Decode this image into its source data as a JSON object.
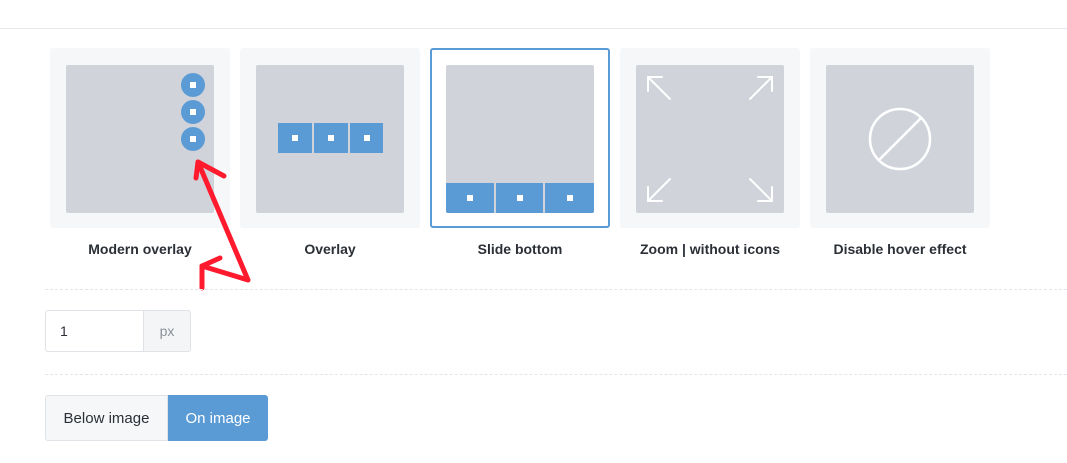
{
  "hover_effects": [
    {
      "label": "Modern overlay",
      "icon": "modern-overlay-thumbnail",
      "selected": false
    },
    {
      "label": "Overlay",
      "icon": "overlay-thumbnail",
      "selected": false
    },
    {
      "label": "Slide bottom",
      "icon": "slide-bottom-thumbnail",
      "selected": true
    },
    {
      "label": "Zoom | without icons",
      "icon": "zoom-thumbnail",
      "selected": false
    },
    {
      "label": "Disable hover effect",
      "icon": "disable-icon",
      "selected": false
    }
  ],
  "border_width": {
    "value": "1",
    "unit": "px"
  },
  "position_toggle": {
    "below_label": "Below image",
    "on_label": "On image",
    "selected": "On image"
  },
  "colors": {
    "accent": "#5b9bd5",
    "thumb_bg": "#d0d4da",
    "card_bg": "#f6f7f9",
    "annotation": "#ff1a2e"
  }
}
